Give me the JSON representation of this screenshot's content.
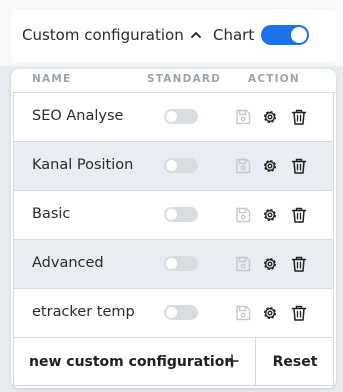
{
  "topbar": {
    "config_label": "Custom configuration",
    "chart_label": "Chart",
    "chart_toggle_on": true,
    "accent_color": "#1a73e8"
  },
  "table": {
    "headers": {
      "name": "NAME",
      "standard": "STANDARD",
      "action": "ACTION"
    },
    "rows": [
      {
        "name": "SEO Analyse",
        "standard": false
      },
      {
        "name": "Kanal Position",
        "standard": false
      },
      {
        "name": "Basic",
        "standard": false
      },
      {
        "name": "Advanced",
        "standard": false
      },
      {
        "name": "etracker temp",
        "standard": false
      }
    ],
    "row_icons": [
      "save-icon",
      "gear-icon",
      "trash-icon"
    ]
  },
  "footer": {
    "new_label": "new custom configuration",
    "reset_label": "Reset"
  }
}
